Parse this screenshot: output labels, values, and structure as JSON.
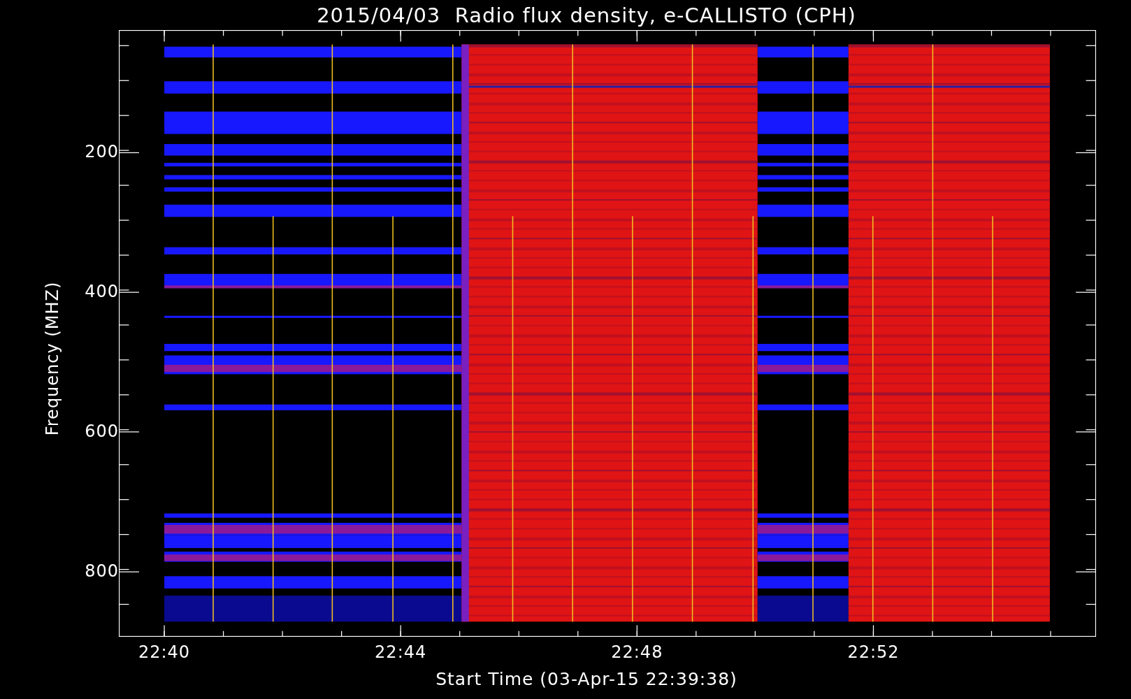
{
  "title": "2015/04/03  Radio flux density, e-CALLISTO (CPH)",
  "ylabel": "Frequency (MHZ)",
  "xlabel": "Start Time (03-Apr-15 22:39:38)",
  "yticks": [
    "200",
    "400",
    "600",
    "800"
  ],
  "xticks": [
    "22:40",
    "22:44",
    "22:48",
    "22:52"
  ]
}
